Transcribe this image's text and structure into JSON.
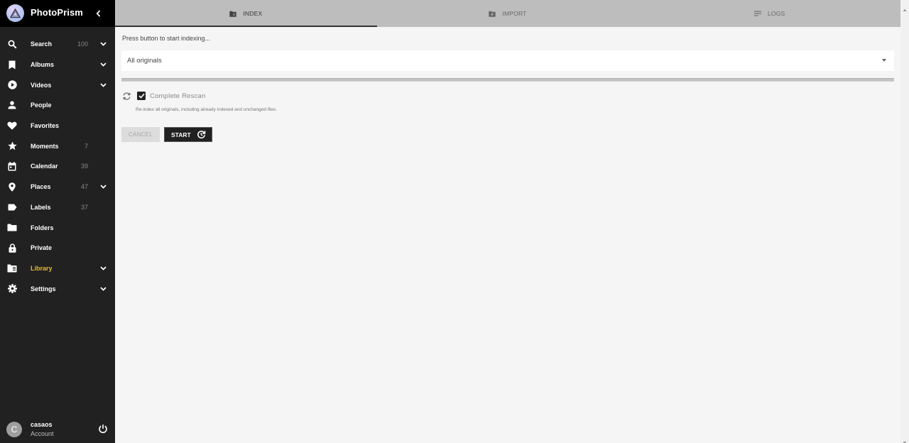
{
  "app": {
    "title": "PhotoPrism",
    "logo_icon": "photoprism-triangle-logo",
    "collapse_icon": "chevron-left-icon"
  },
  "sidebar": {
    "items": [
      {
        "label": "Search",
        "icon": "search-icon",
        "count": "100",
        "expandable": true,
        "active": false
      },
      {
        "label": "Albums",
        "icon": "bookmark-icon",
        "count": "",
        "expandable": true,
        "active": false
      },
      {
        "label": "Videos",
        "icon": "play-circle-icon",
        "count": "",
        "expandable": true,
        "active": false
      },
      {
        "label": "People",
        "icon": "person-icon",
        "count": "",
        "expandable": false,
        "active": false
      },
      {
        "label": "Favorites",
        "icon": "heart-icon",
        "count": "",
        "expandable": false,
        "active": false
      },
      {
        "label": "Moments",
        "icon": "star-icon",
        "count": "7",
        "expandable": false,
        "active": false
      },
      {
        "label": "Calendar",
        "icon": "calendar-icon",
        "count": "39",
        "expandable": false,
        "active": false
      },
      {
        "label": "Places",
        "icon": "map-marker-icon",
        "count": "47",
        "expandable": true,
        "active": false
      },
      {
        "label": "Labels",
        "icon": "label-icon",
        "count": "37",
        "expandable": false,
        "active": false
      },
      {
        "label": "Folders",
        "icon": "folder-icon",
        "count": "",
        "expandable": false,
        "active": false
      },
      {
        "label": "Private",
        "icon": "lock-icon",
        "count": "",
        "expandable": false,
        "active": false
      },
      {
        "label": "Library",
        "icon": "library-icon",
        "count": "",
        "expandable": true,
        "active": true
      },
      {
        "label": "Settings",
        "icon": "gear-icon",
        "count": "",
        "expandable": true,
        "active": false
      }
    ],
    "account": {
      "avatar_letter": "C",
      "name": "casaos",
      "subtitle": "Account",
      "logout_icon": "power-icon"
    }
  },
  "tabs": [
    {
      "label": "INDEX",
      "icon": "folder-cog-icon",
      "active": true
    },
    {
      "label": "IMPORT",
      "icon": "folder-plus-icon",
      "active": false
    },
    {
      "label": "LOGS",
      "icon": "notes-icon",
      "active": false
    }
  ],
  "main": {
    "status_text": "Press button to start indexing...",
    "folder_select": {
      "value": "All originals"
    },
    "progress_percent": 0,
    "rescan": {
      "label": "Complete Rescan",
      "checked": true,
      "hint": "Re-index all originals, including already indexed and unchanged files."
    },
    "cancel_label": "CANCEL",
    "start_label": "START"
  },
  "colors": {
    "sidebar_bg": "#212121",
    "sidebar_header_bg": "#000000",
    "active_accent": "#e8b82a",
    "tabs_bg": "#bdbdbd",
    "main_bg": "#f5f5f5"
  }
}
